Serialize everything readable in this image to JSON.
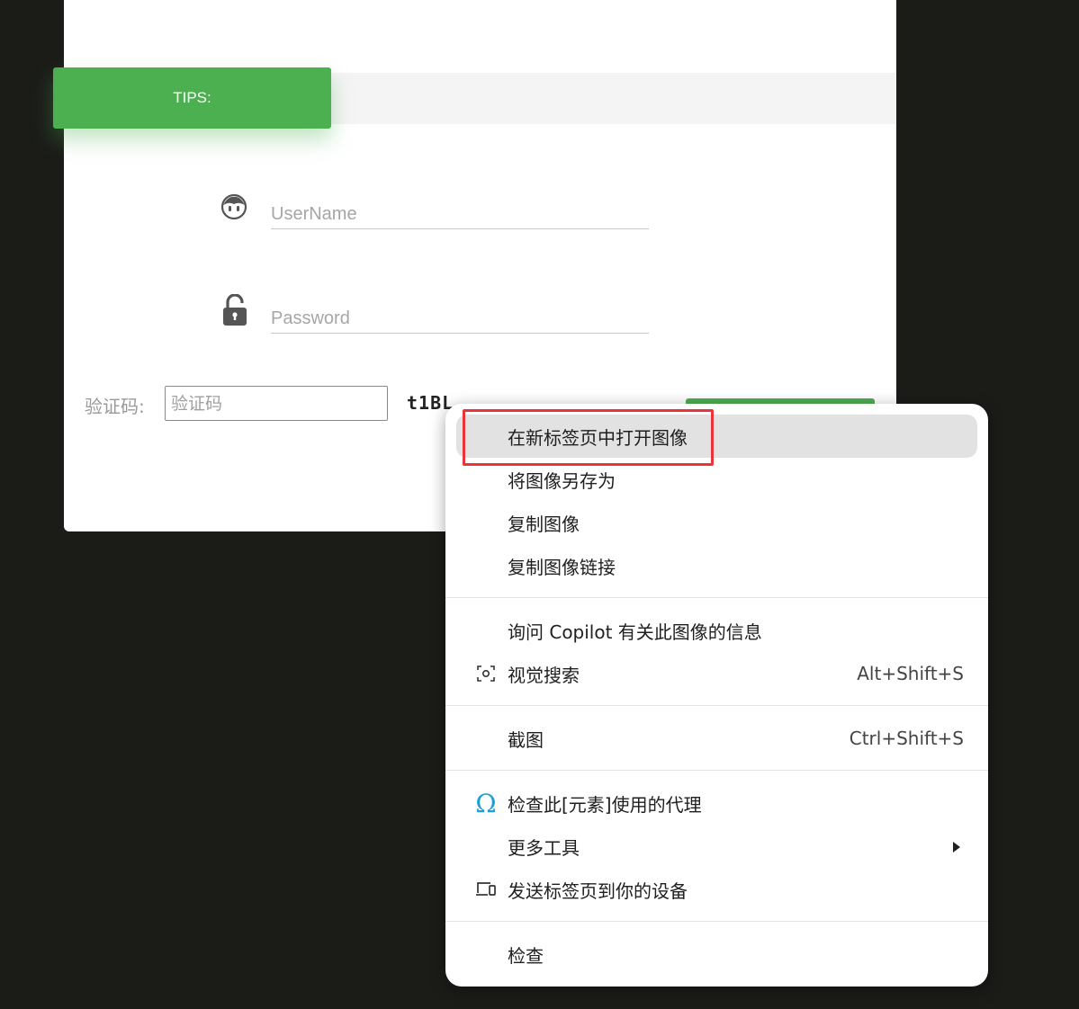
{
  "login": {
    "tips_label": "TIPS:",
    "username_placeholder": "UserName",
    "password_placeholder": "Password",
    "captcha_label": "验证码:",
    "captcha_placeholder": "验证码",
    "captcha_text": "t1BL",
    "accent_color": "#4caf50"
  },
  "menu": {
    "items": [
      {
        "label": "在新标签页中打开图像"
      },
      {
        "label": "将图像另存为"
      },
      {
        "label": "复制图像"
      },
      {
        "label": "复制图像链接"
      },
      {
        "label": "询问 Copilot 有关此图像的信息"
      },
      {
        "label": "视觉搜索",
        "shortcut": "Alt+Shift+S",
        "icon": "visual-search-icon"
      },
      {
        "label": "截图",
        "shortcut": "Ctrl+Shift+S"
      },
      {
        "label": "检查此[元素]使用的代理",
        "icon": "omega-icon"
      },
      {
        "label": "更多工具",
        "icon": "chevron-right-icon"
      },
      {
        "label": "发送标签页到你的设备",
        "icon": "devices-icon"
      },
      {
        "label": "检查"
      }
    ],
    "highlight_color": "#e8343a",
    "omega_color": "#1a9fd8"
  }
}
